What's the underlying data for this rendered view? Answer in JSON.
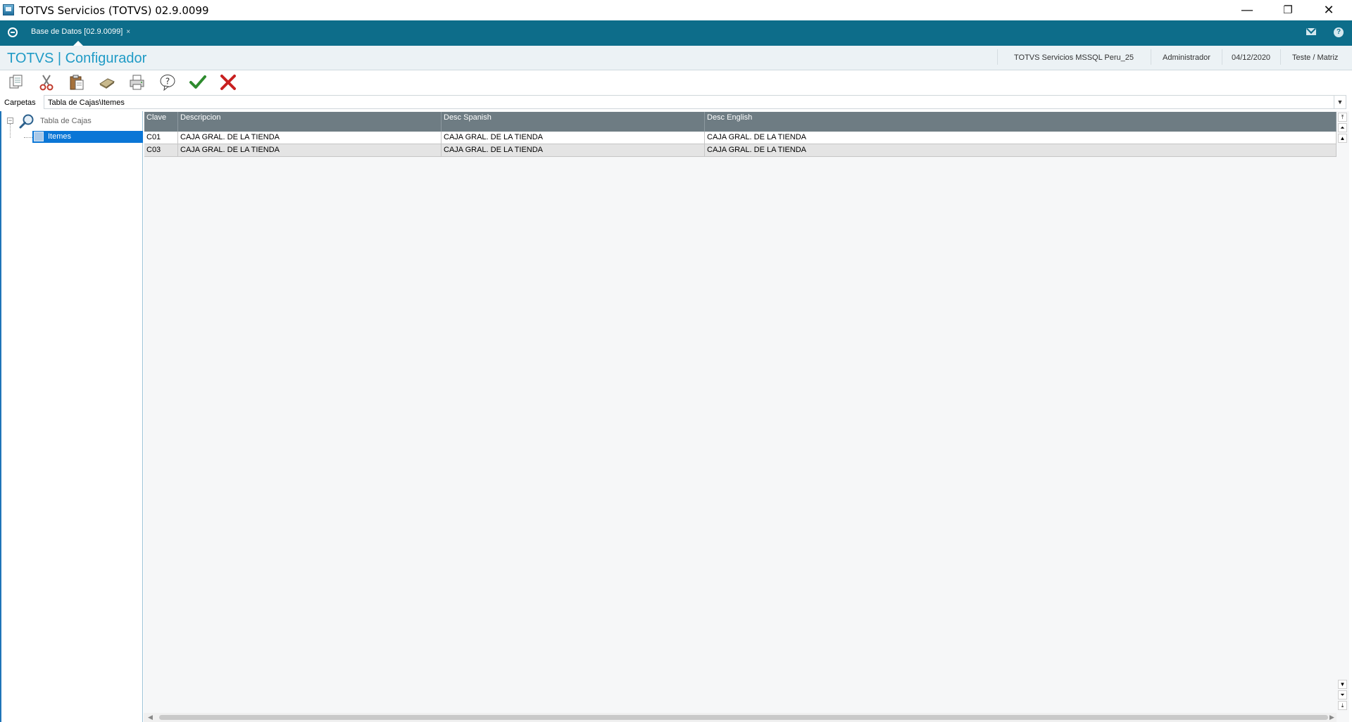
{
  "window": {
    "title": "TOTVS Servicios (TOTVS) 02.9.0099",
    "minimize_glyph": "—",
    "restore_glyph": "❐",
    "close_glyph": "✕"
  },
  "tabs": [
    {
      "label": "Base de Datos [02.9.0099]",
      "close": "×"
    }
  ],
  "header": {
    "title": "TOTVS | Configurador",
    "environment": "TOTVS Servicios MSSQL Peru_25",
    "user": "Administrador",
    "date": "04/12/2020",
    "branch": "Teste / Matriz"
  },
  "toolbar": {
    "buttons": [
      {
        "name": "copy-icon"
      },
      {
        "name": "cut-icon"
      },
      {
        "name": "paste-icon"
      },
      {
        "name": "eraser-icon"
      },
      {
        "name": "print-icon"
      },
      {
        "name": "help-bubble-icon"
      },
      {
        "name": "confirm-check-icon"
      },
      {
        "name": "cancel-x-icon"
      }
    ]
  },
  "folder": {
    "label": "Carpetas",
    "value": "Tabla de Cajas\\Itemes"
  },
  "tree": {
    "root_label": "Tabla de Cajas",
    "expander": "−",
    "child_label": "Itemes"
  },
  "grid": {
    "columns": [
      "Clave",
      "Descripcion",
      "Desc Spanish",
      "Desc English"
    ],
    "rows": [
      [
        "C01",
        "CAJA GRAL. DE LA TIENDA",
        "CAJA GRAL. DE LA TIENDA",
        "CAJA GRAL. DE LA TIENDA"
      ],
      [
        "C03",
        "CAJA GRAL. DE LA TIENDA",
        "CAJA GRAL. DE LA TIENDA",
        "CAJA GRAL. DE LA TIENDA"
      ]
    ]
  },
  "colors": {
    "tabbar": "#0d6d8a",
    "title_accent": "#1f9bc6",
    "selection": "#0a76d6",
    "grid_header": "#6e7c83"
  }
}
